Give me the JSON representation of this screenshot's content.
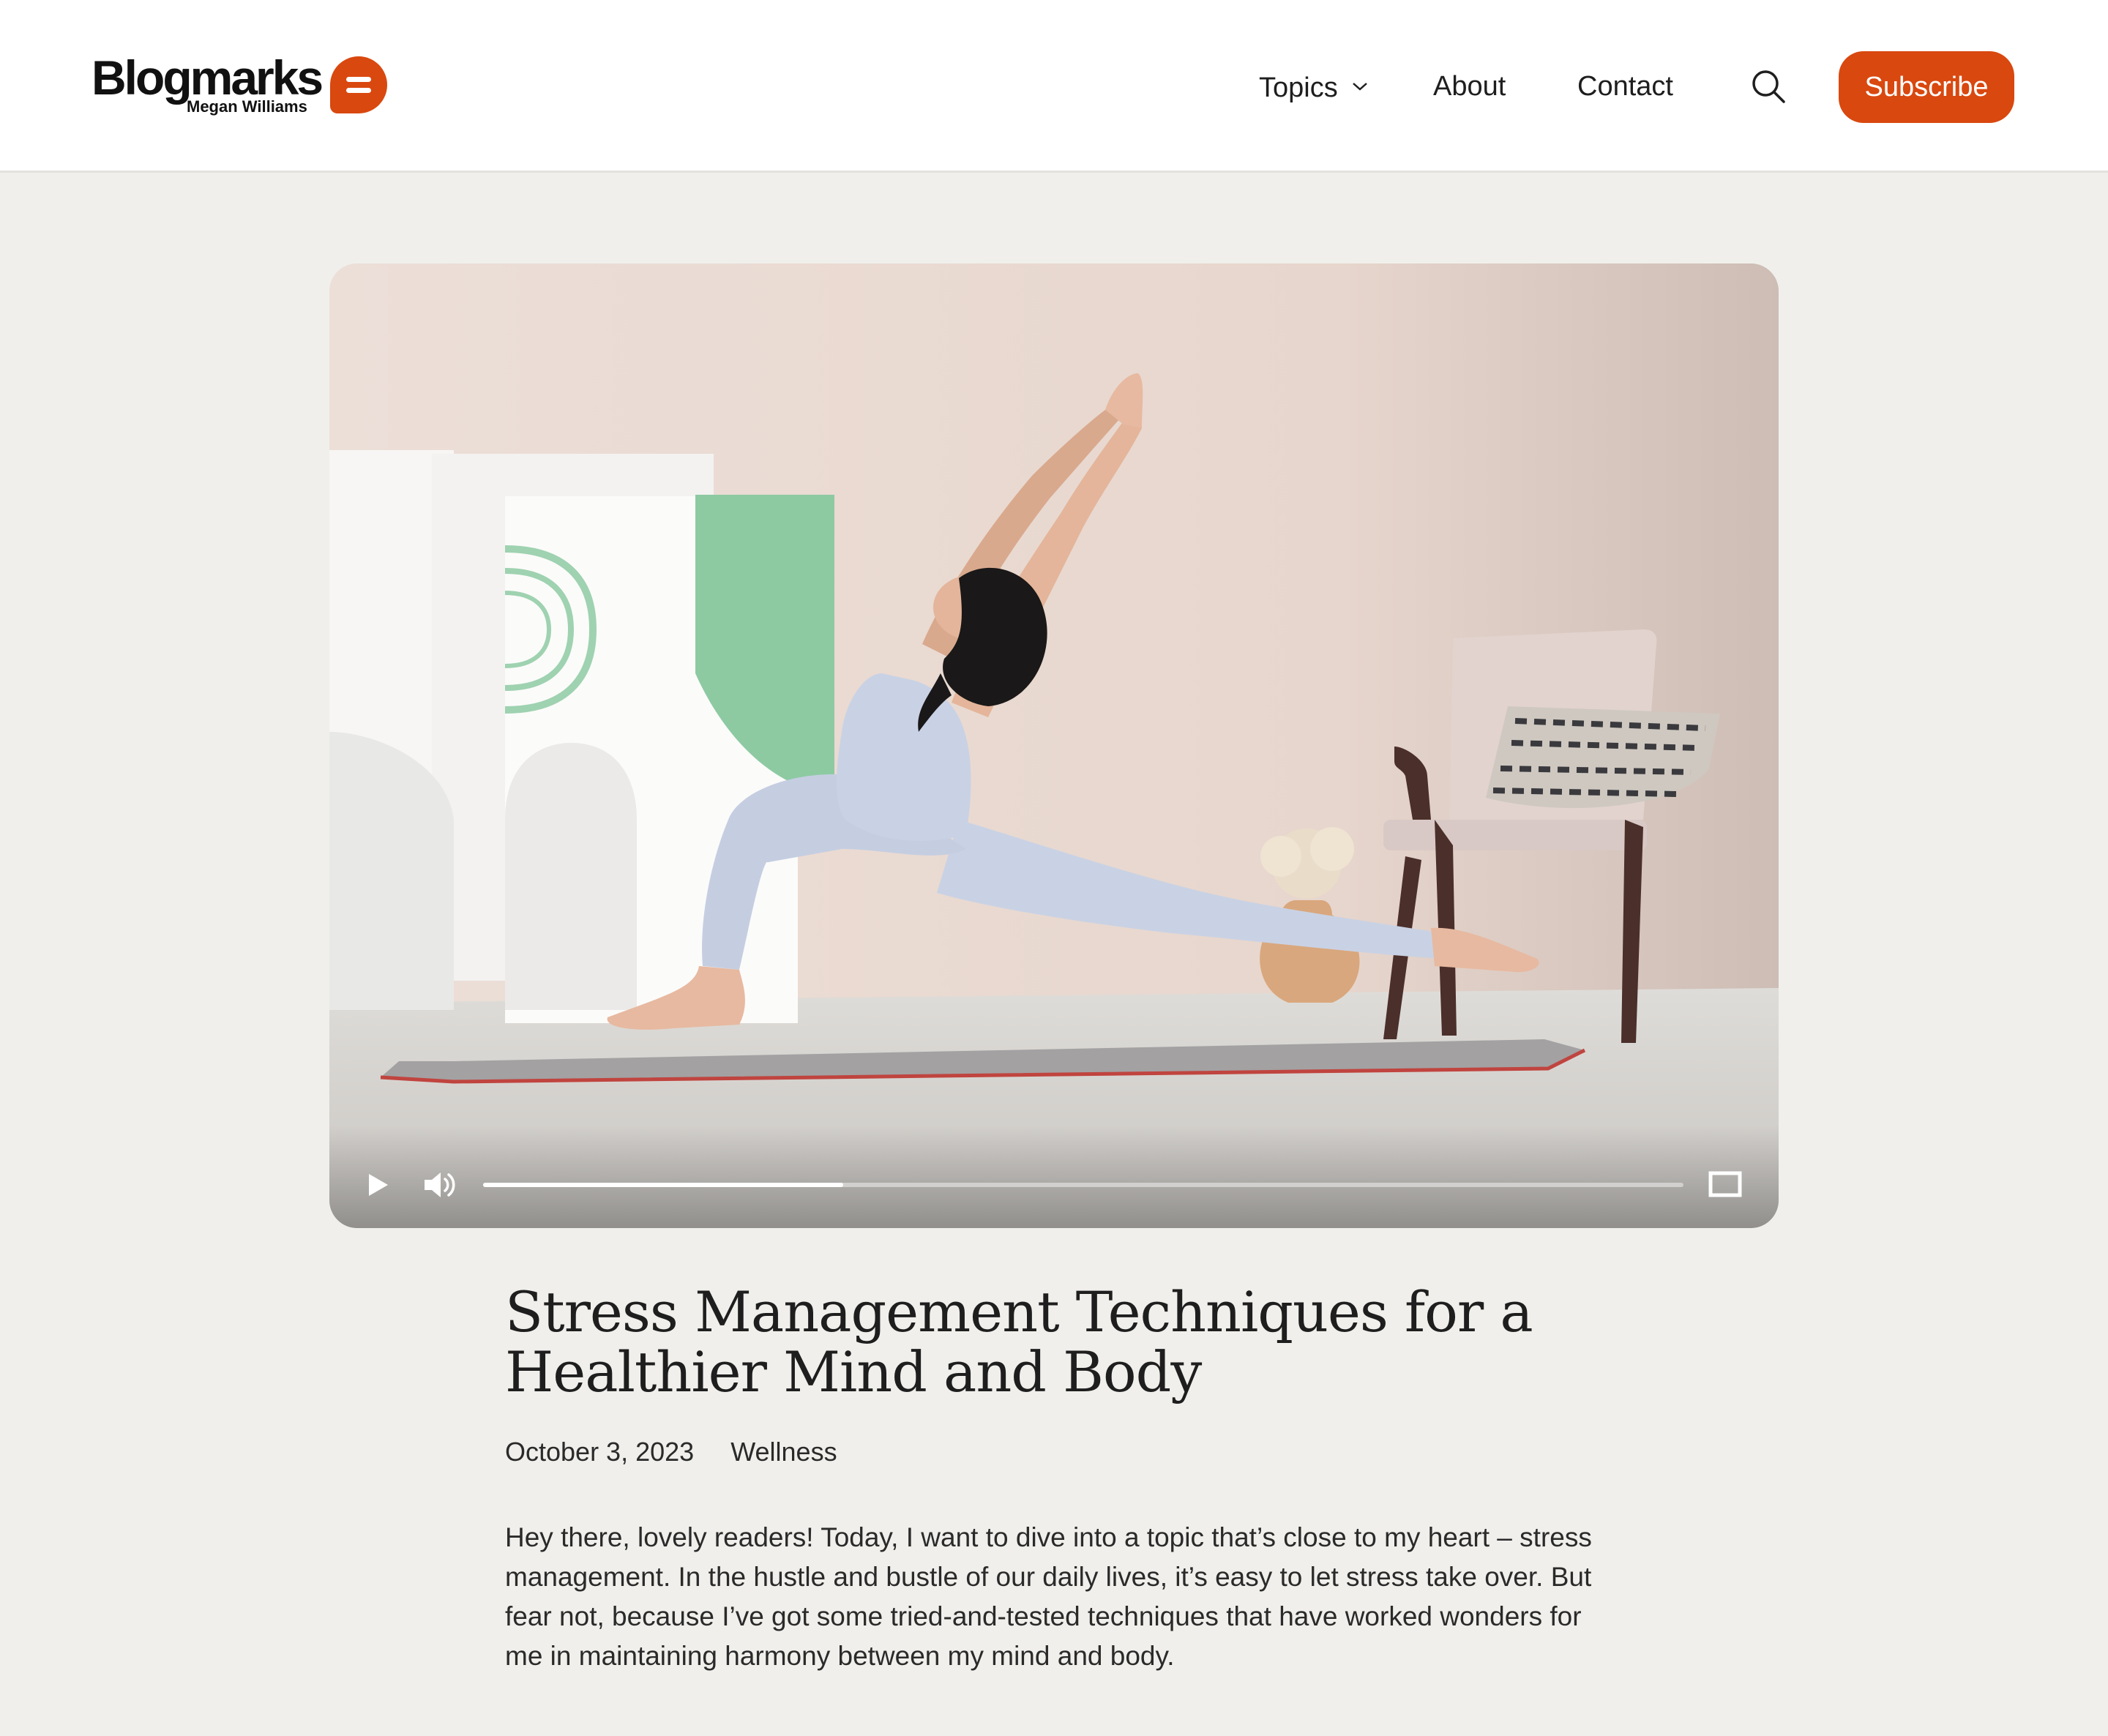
{
  "header": {
    "brand_name": "Blogmarks",
    "brand_owner": "Megan Williams",
    "nav": {
      "topics": "Topics",
      "about": "About",
      "contact": "Contact"
    },
    "search_icon": "search-icon",
    "subscribe_label": "Subscribe",
    "accent_color": "#d9480f"
  },
  "video": {
    "progress": 0.3,
    "controls": [
      "play-icon",
      "volume-icon",
      "progress-bar",
      "fullscreen-icon"
    ]
  },
  "article": {
    "title": "Stress Management Techniques for a Healthier Mind and Body",
    "date": "October 3, 2023",
    "category": "Wellness",
    "intro": "Hey there, lovely readers! Today, I want to dive into a topic that’s close to my heart – stress management. In the hustle and bustle of our daily lives, it’s easy to let stress take over. But fear not, because I’ve got some tried-and-tested techniques that have worked wonders for me in maintaining harmony between my mind and body."
  }
}
